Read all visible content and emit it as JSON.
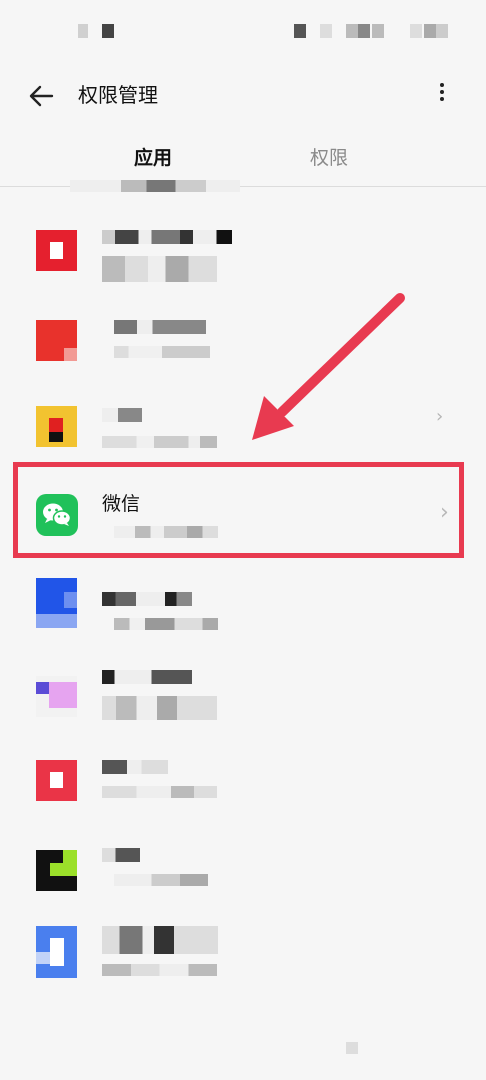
{
  "header": {
    "title": "权限管理"
  },
  "tabs": [
    {
      "label": "应用",
      "active": true
    },
    {
      "label": "权限",
      "active": false
    }
  ],
  "highlighted_app": {
    "name": "微信"
  },
  "annotation": {
    "color": "#e83a50"
  },
  "icons": {
    "back": "arrow-left-icon",
    "more": "more-vertical-icon",
    "chevron": "chevron-right-icon",
    "wechat": "wechat-icon"
  },
  "colors": {
    "wechat_green": "#20c15a",
    "highlight": "#e83a50",
    "background": "#f6f6f6"
  }
}
